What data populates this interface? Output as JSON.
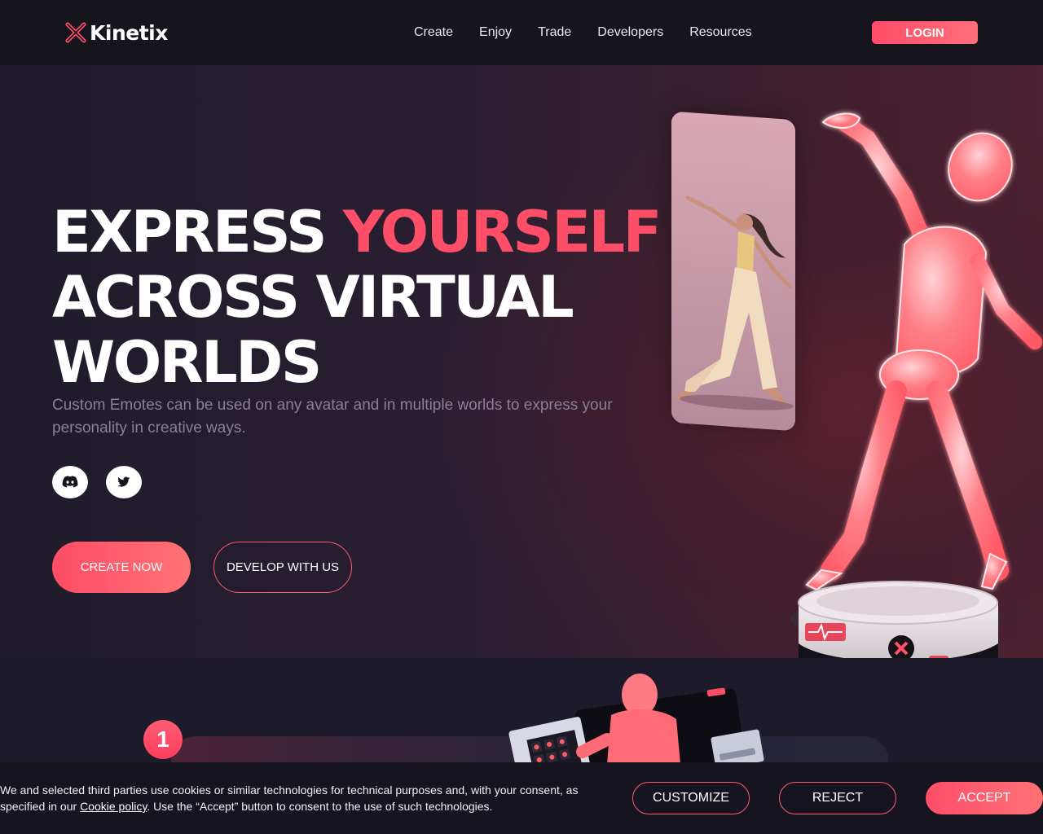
{
  "brand": {
    "name": "Kinetix",
    "icon": "x-logo-icon",
    "accent": "#ff4f68"
  },
  "nav": {
    "items": [
      {
        "label": "Create"
      },
      {
        "label": "Enjoy"
      },
      {
        "label": "Trade"
      },
      {
        "label": "Developers"
      },
      {
        "label": "Resources"
      }
    ],
    "login_label": "LOGIN"
  },
  "hero": {
    "headline_part1": "EXPRESS ",
    "headline_accent": "YOURSELF",
    "headline_part2": "ACROSS VIRTUAL",
    "headline_part3": "WORLDS",
    "subtext": "Custom Emotes can be used on any avatar and in multiple worlds to express your personality in creative ways.",
    "social": [
      {
        "icon": "discord-icon"
      },
      {
        "icon": "twitter-icon"
      }
    ],
    "primary_cta": "CREATE NOW",
    "secondary_cta": "DEVELOP WITH US"
  },
  "steps": {
    "first_step_number": "1"
  },
  "cookie_banner": {
    "text_before_link": "We and selected third parties use cookies or similar technologies for technical purposes and, with your consent, as specified in our ",
    "link_label": "Cookie policy",
    "text_after_link": ". Use the “Accept” button to consent to the use of such technologies.",
    "customize_label": "CUSTOMIZE",
    "reject_label": "REJECT",
    "accept_label": "ACCEPT"
  }
}
